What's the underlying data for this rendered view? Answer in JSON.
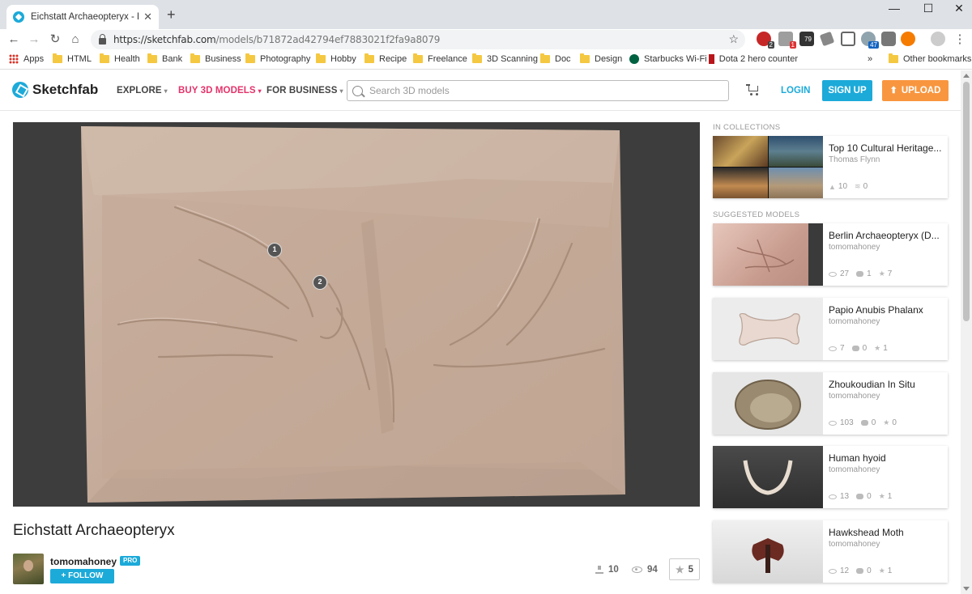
{
  "browser": {
    "tab_title": "Eichstatt Archaeopteryx - Download",
    "url_host": "https://sketchfab.com",
    "url_path": "/models/b71872ad42794ef7883021f2fa9a8079",
    "bookmarks": [
      "Apps",
      "HTML",
      "Health",
      "Bank",
      "Business",
      "Photography",
      "Hobby",
      "Recipe",
      "Freelance",
      "3D Scanning",
      "Doc",
      "Design",
      "Starbucks Wi-Fi",
      "Dota 2 hero counter"
    ],
    "other_bookmarks": "Other bookmarks",
    "more_bookmarks": "»",
    "extension_badges": [
      "2",
      "1",
      "79",
      "47"
    ]
  },
  "header": {
    "logo": "Sketchfab",
    "nav": [
      "EXPLORE",
      "BUY 3D MODELS",
      "FOR BUSINESS"
    ],
    "search_placeholder": "Search 3D models",
    "login": "LOGIN",
    "signup": "SIGN UP",
    "upload": "UPLOAD"
  },
  "model": {
    "title": "Eichstatt Archaeopteryx",
    "author": "tomomahoney",
    "pro_badge": "PRO",
    "follow": "+ FOLLOW",
    "downloads": "10",
    "views": "94",
    "likes": "5",
    "hotspots": [
      "1",
      "2"
    ]
  },
  "sidebar": {
    "collections_label": "IN COLLECTIONS",
    "collection": {
      "title": "Top 10 Cultural Heritage...",
      "author": "Thomas Flynn",
      "models": "10",
      "subscribers": "0"
    },
    "suggested_label": "SUGGESTED MODELS",
    "suggested": [
      {
        "title": "Berlin Archaeopteryx (D...",
        "author": "tomomahoney",
        "views": "27",
        "comments": "1",
        "likes": "7"
      },
      {
        "title": "Papio Anubis Phalanx",
        "author": "tomomahoney",
        "views": "7",
        "comments": "0",
        "likes": "1"
      },
      {
        "title": "Zhoukoudian In Situ",
        "author": "tomomahoney",
        "views": "103",
        "comments": "0",
        "likes": "0"
      },
      {
        "title": "Human hyoid",
        "author": "tomomahoney",
        "views": "13",
        "comments": "0",
        "likes": "1"
      },
      {
        "title": "Hawkshead Moth",
        "author": "tomomahoney",
        "views": "12",
        "comments": "0",
        "likes": "1"
      }
    ]
  },
  "colors": {
    "accent": "#1caad9",
    "pink": "#e4336b",
    "orange": "#f8963f",
    "fossil": "#c9b1a1"
  }
}
